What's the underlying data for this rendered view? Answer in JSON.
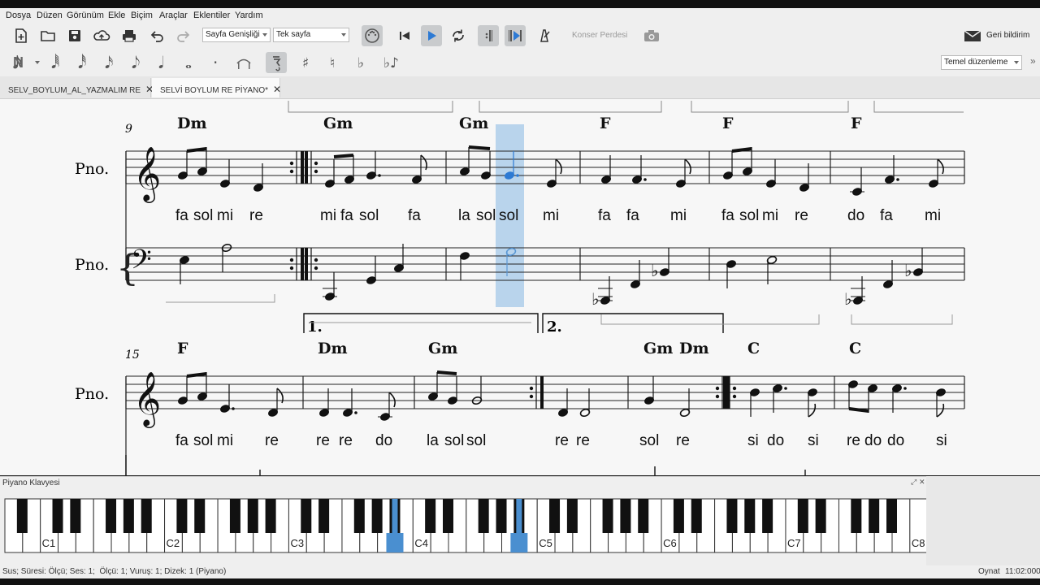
{
  "menu": [
    "Dosya",
    "Düzen",
    "Görünüm",
    "Ekle",
    "Biçim",
    "Araçlar",
    "Eklentiler",
    "Yardım"
  ],
  "toolbar": {
    "page_view": "Sayfa Genişliği",
    "page_mode": "Tek sayfa",
    "concert_pitch": "Konser Perdesi",
    "feedback": "Geri bildirim"
  },
  "note_input": {
    "voices": [
      "1",
      "2",
      "3",
      "4"
    ],
    "selected_voice": "1",
    "workspace": "Temel düzenleme"
  },
  "tabs": [
    {
      "label": "SELV_BOYLUM_AL_YAZMALIM RE",
      "active": false
    },
    {
      "label": "SELVİ BOYLUM RE PİYANO*",
      "active": true
    }
  ],
  "score": {
    "instrument_label": "Pno.",
    "system1": {
      "measure_number": "9",
      "chords": [
        "Dm",
        "Gm",
        "Gm",
        "F",
        "F",
        "F"
      ],
      "lyrics": [
        "fa",
        "sol",
        "mi",
        "re",
        "mi",
        "fa",
        "sol",
        "fa",
        "la",
        "sol",
        "sol",
        "mi",
        "fa",
        "fa",
        "mi",
        "fa",
        "sol",
        "mi",
        "re",
        "do",
        "fa",
        "mi"
      ]
    },
    "volta_1": "1.",
    "volta_2": "2.",
    "system2": {
      "measure_number": "15",
      "chords": [
        "F",
        "Dm",
        "Gm",
        "Gm",
        "Dm",
        "C",
        "C"
      ],
      "lyrics": [
        "fa",
        "sol",
        "mi",
        "re",
        "re",
        "re",
        "do",
        "la",
        "sol",
        "sol",
        "re",
        "re",
        "sol",
        "re",
        "si",
        "do",
        "si",
        "re",
        "do",
        "do",
        "si"
      ]
    }
  },
  "piano": {
    "title": "Piyano Klavyesi",
    "octave_labels": [
      "C1",
      "C2",
      "C3",
      "C4",
      "C5",
      "C6",
      "C7",
      "C8"
    ],
    "highlighted_keys": [
      "A#3",
      "A#4"
    ],
    "highlight_color": "#4a8fd0"
  },
  "status": {
    "left": "Sus; Süresi: Ölçü; Ses: 1;  Ölçü: 1; Vuruş: 1; Dizek: 1 (Piyano)",
    "mode": "Oynat",
    "time": "11:02:000"
  },
  "colors": {
    "accent": "#3c8ad8",
    "selection": "#b9d4ec"
  }
}
